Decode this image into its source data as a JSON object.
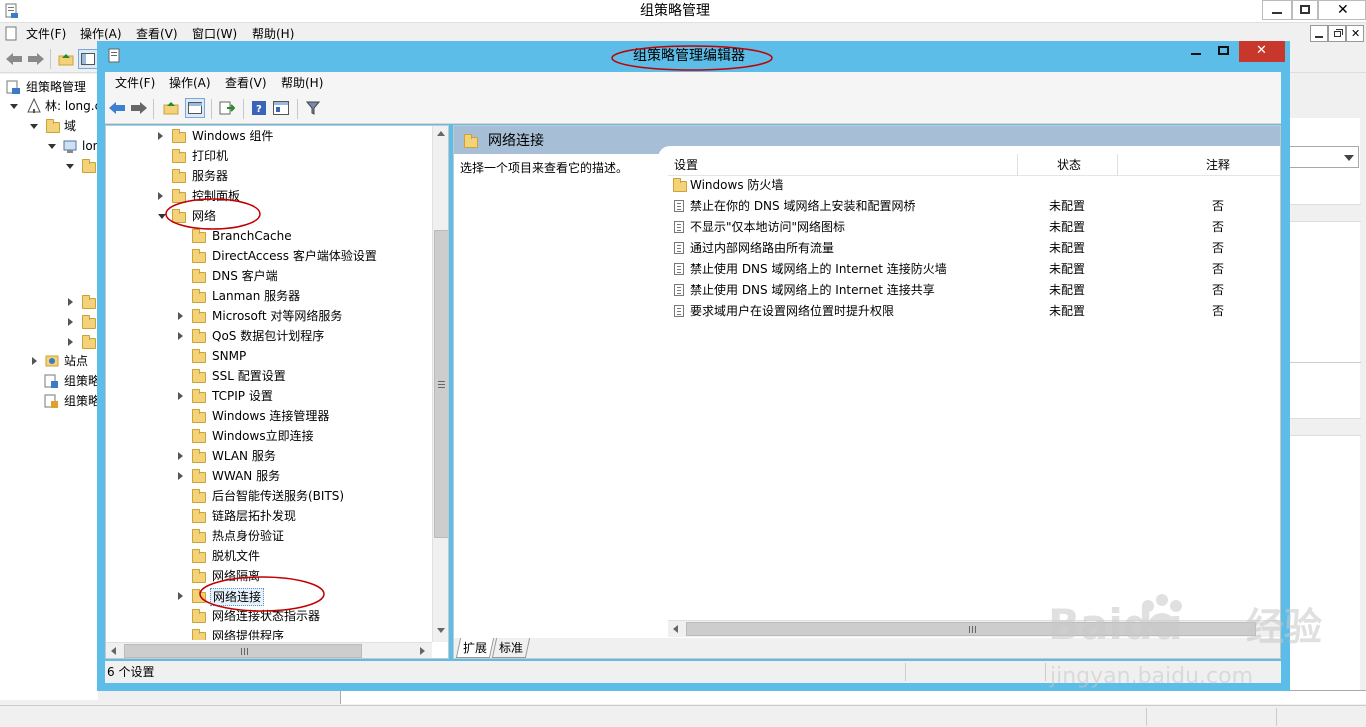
{
  "outer": {
    "title": "组策略管理",
    "menu": [
      "文件(F)",
      "操作(A)",
      "查看(V)",
      "窗口(W)",
      "帮助(H)"
    ],
    "tree": [
      "组策略管理",
      "林: long.c",
      "域",
      "lon",
      "站点",
      "组策略",
      "组策略"
    ]
  },
  "editor": {
    "title": "组策略管理编辑器",
    "menu": [
      "文件(F)",
      "操作(A)",
      "查看(V)",
      "帮助(H)"
    ],
    "tree": [
      {
        "label": "Windows 组件",
        "expander": "closed"
      },
      {
        "label": "打印机",
        "expander": "none"
      },
      {
        "label": "服务器",
        "expander": "none"
      },
      {
        "label": "控制面板",
        "expander": "closed"
      },
      {
        "label": "网络",
        "expander": "open"
      },
      {
        "label": "BranchCache",
        "expander": "none"
      },
      {
        "label": "DirectAccess 客户端体验设置",
        "expander": "none"
      },
      {
        "label": "DNS 客户端",
        "expander": "none"
      },
      {
        "label": "Lanman 服务器",
        "expander": "none"
      },
      {
        "label": "Microsoft 对等网络服务",
        "expander": "closed"
      },
      {
        "label": "QoS 数据包计划程序",
        "expander": "closed"
      },
      {
        "label": "SNMP",
        "expander": "none"
      },
      {
        "label": "SSL 配置设置",
        "expander": "none"
      },
      {
        "label": "TCPIP 设置",
        "expander": "closed"
      },
      {
        "label": "Windows 连接管理器",
        "expander": "none"
      },
      {
        "label": "Windows立即连接",
        "expander": "none"
      },
      {
        "label": "WLAN 服务",
        "expander": "closed"
      },
      {
        "label": "WWAN 服务",
        "expander": "closed"
      },
      {
        "label": "后台智能传送服务(BITS)",
        "expander": "none"
      },
      {
        "label": "链路层拓扑发现",
        "expander": "none"
      },
      {
        "label": "热点身份验证",
        "expander": "none"
      },
      {
        "label": "脱机文件",
        "expander": "none"
      },
      {
        "label": "网络隔离",
        "expander": "none"
      },
      {
        "label": "网络连接",
        "expander": "closed"
      },
      {
        "label": "网络连接状态指示器",
        "expander": "none"
      },
      {
        "label": "网络提供程序",
        "expander": "none"
      }
    ],
    "right": {
      "header": "网络连接",
      "description": "选择一个项目来查看它的描述。",
      "columns": [
        "设置",
        "状态",
        "注释"
      ],
      "folder_row": "Windows 防火墙",
      "rows": [
        {
          "setting": "禁止在你的 DNS 域网络上安装和配置网桥",
          "state": "未配置",
          "comment": "否"
        },
        {
          "setting": "不显示\"仅本地访问\"网络图标",
          "state": "未配置",
          "comment": "否"
        },
        {
          "setting": "通过内部网络路由所有流量",
          "state": "未配置",
          "comment": "否"
        },
        {
          "setting": "禁止使用 DNS 域网络上的 Internet 连接防火墙",
          "state": "未配置",
          "comment": "否"
        },
        {
          "setting": "禁止使用 DNS 域网络上的 Internet 连接共享",
          "state": "未配置",
          "comment": "否"
        },
        {
          "setting": "要求域用户在设置网络位置时提升权限",
          "state": "未配置",
          "comment": "否"
        }
      ],
      "tabs": [
        "扩展",
        "标准"
      ]
    },
    "status": "6 个设置"
  },
  "watermark": {
    "brand": "Baidu",
    "cn": "经验",
    "url": "jingyan.baidu.com"
  },
  "colors": {
    "frame": "#5bbde8",
    "header_band": "#a7bfd6",
    "close": "#c7372c",
    "annotation": "#c00000"
  }
}
